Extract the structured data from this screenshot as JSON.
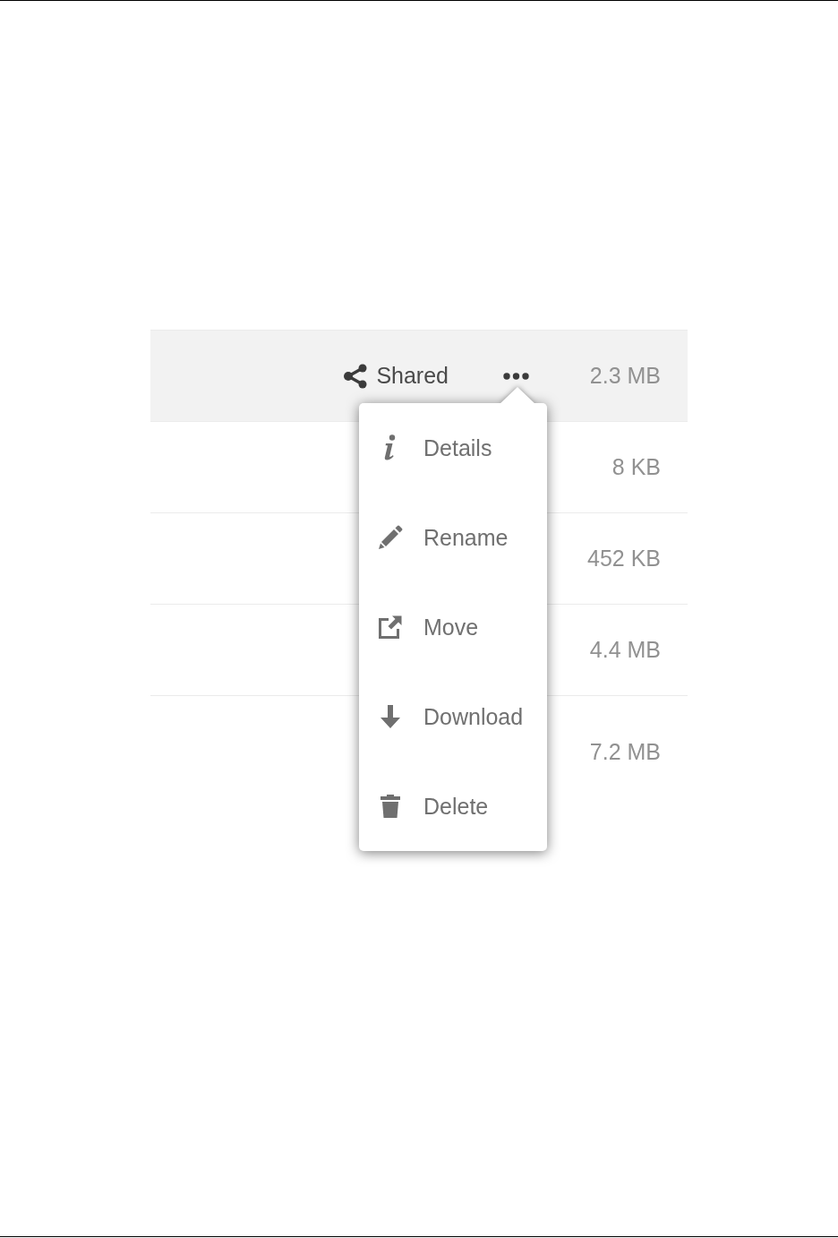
{
  "rows": [
    {
      "selected": true,
      "share": {
        "label": "Shared"
      },
      "menu_open": true,
      "size": "2.3 MB"
    },
    {
      "selected": false,
      "menu_open": false,
      "size": "8 KB"
    },
    {
      "selected": false,
      "menu_open": false,
      "size": "452 KB"
    },
    {
      "selected": false,
      "menu_open": false,
      "size": "4.4 MB"
    },
    {
      "selected": false,
      "menu_open": false,
      "size": "7.2 MB"
    }
  ],
  "menu": {
    "items": [
      {
        "kind": "info",
        "label": "Details"
      },
      {
        "kind": "pencil",
        "label": "Rename"
      },
      {
        "kind": "move",
        "label": "Move"
      },
      {
        "kind": "download",
        "label": "Download"
      },
      {
        "kind": "trash",
        "label": "Delete"
      }
    ]
  }
}
